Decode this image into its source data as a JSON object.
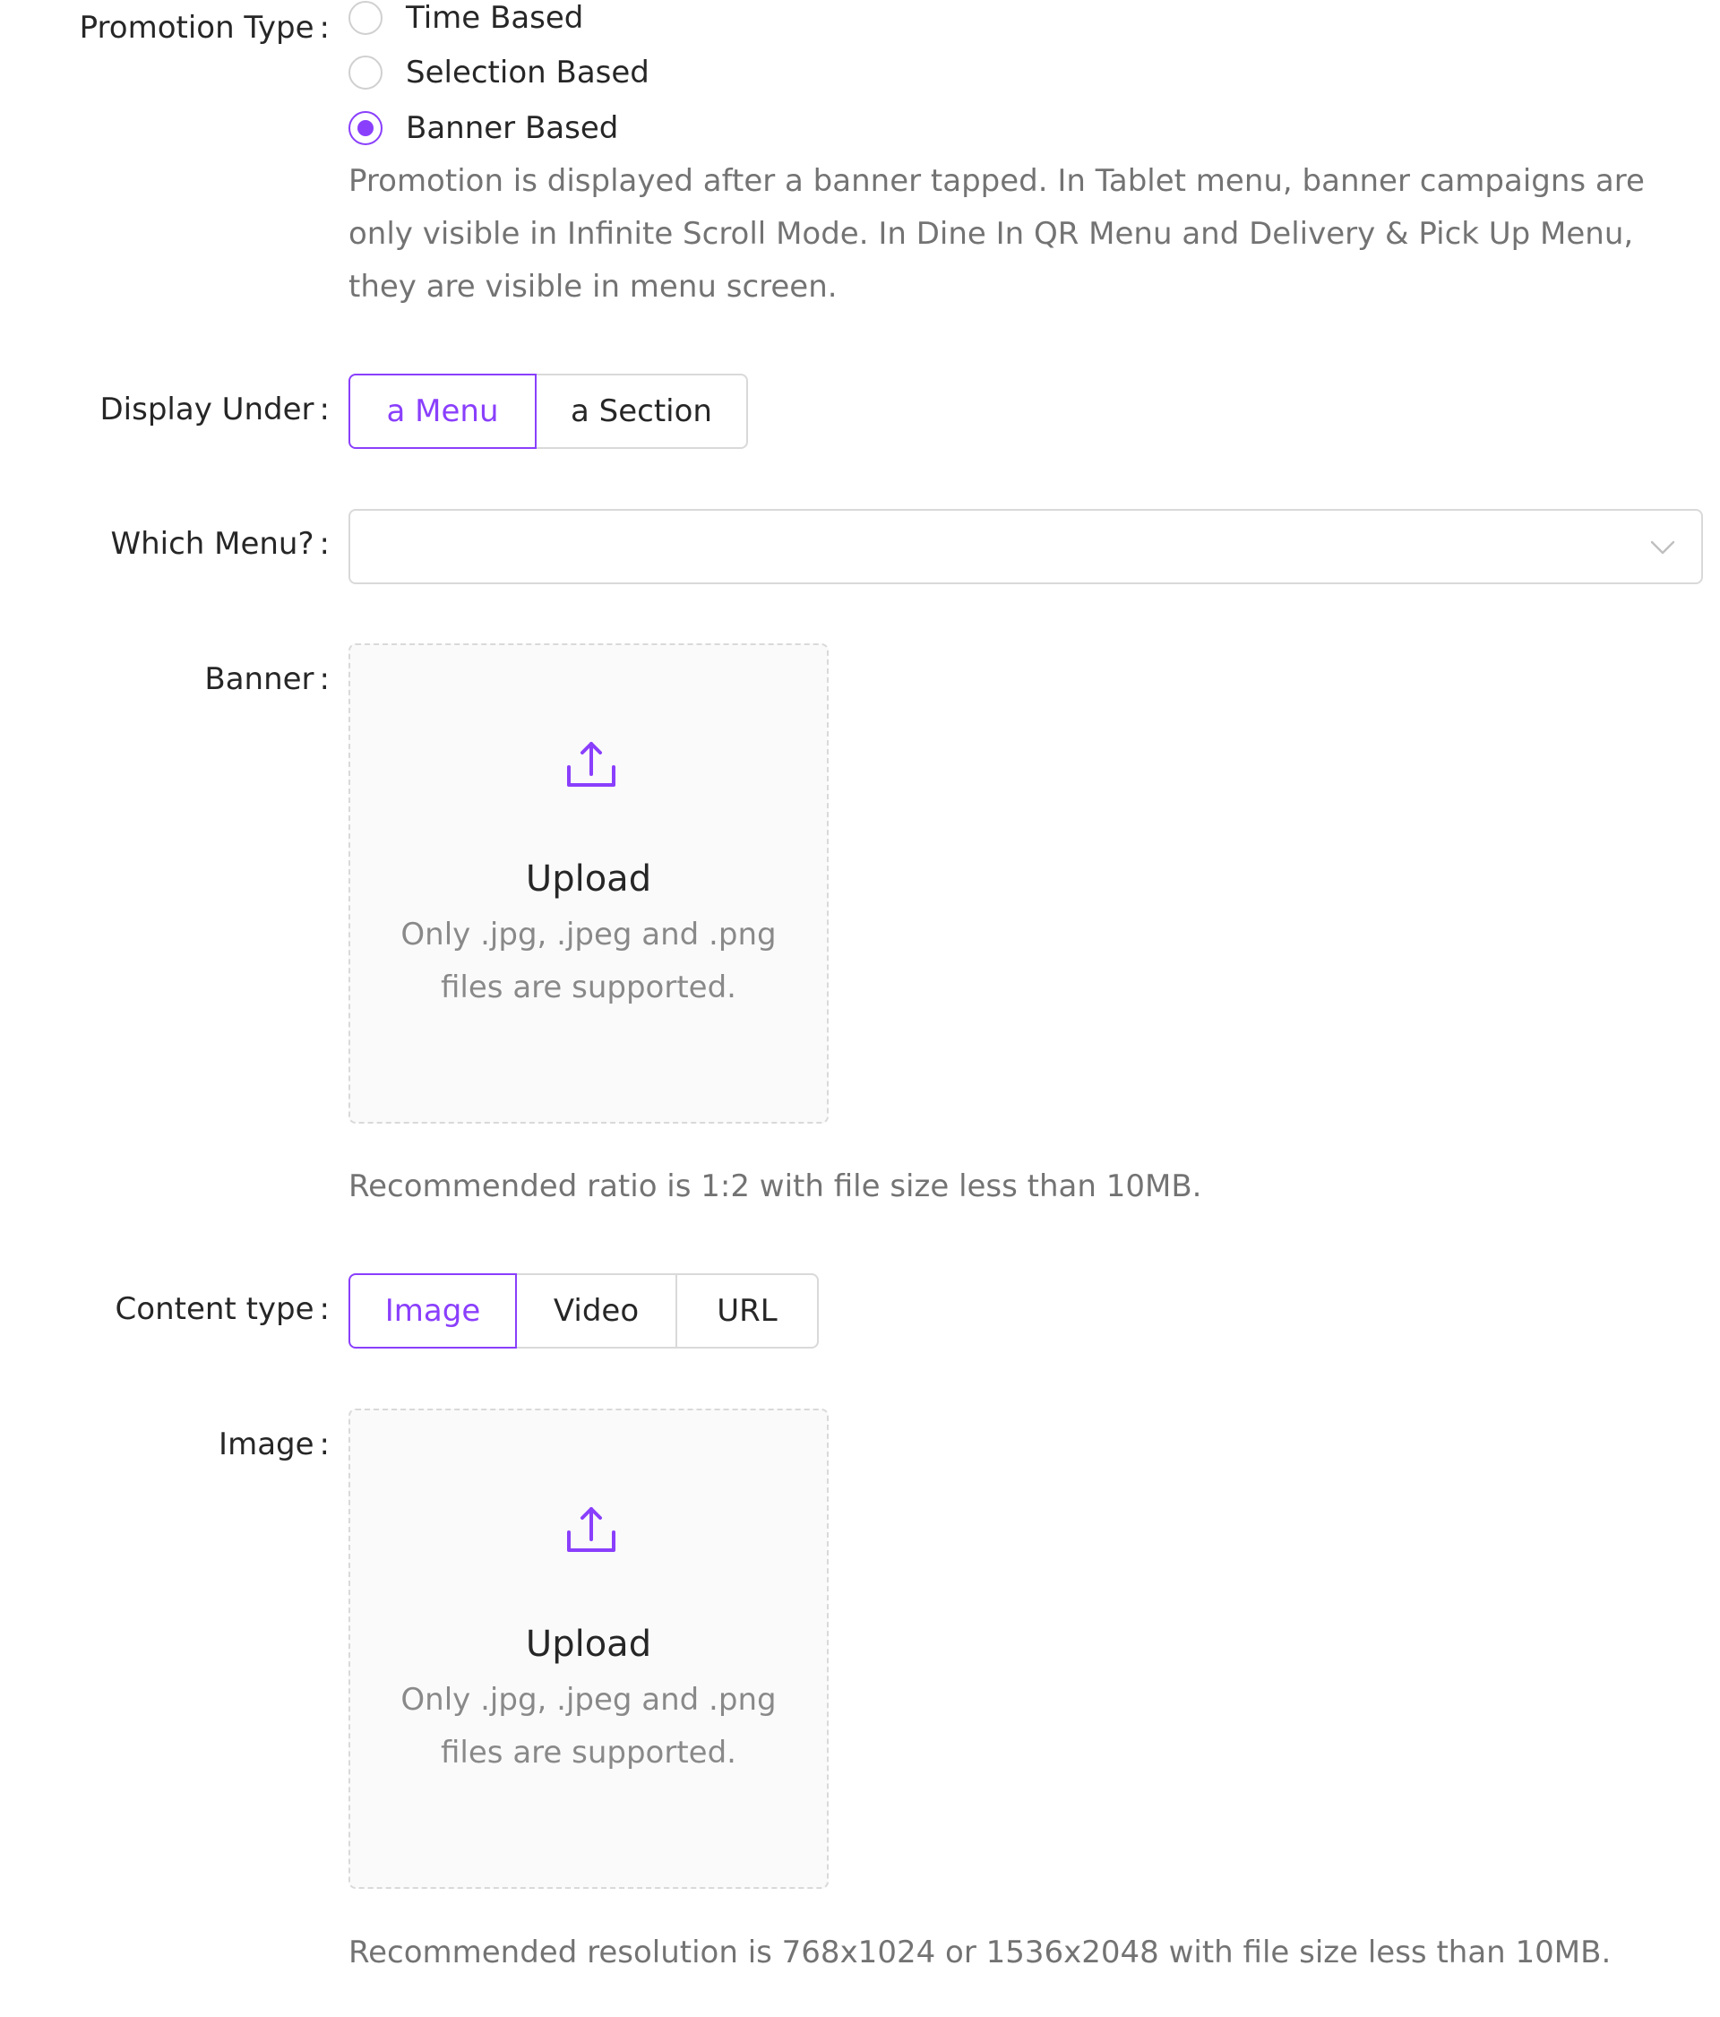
{
  "promotion_type": {
    "label": "Promotion Type",
    "options": [
      {
        "label": "Time Based",
        "checked": false
      },
      {
        "label": "Selection Based",
        "checked": false
      },
      {
        "label": "Banner Based",
        "checked": true
      }
    ],
    "help": "Promotion is displayed after a banner tapped. In Tablet menu, banner campaigns are only visible in Infinite Scroll Mode. In Dine In QR Menu and Delivery & Pick Up Menu, they are visible in menu screen."
  },
  "display_under": {
    "label": "Display Under",
    "options": [
      "a Menu",
      "a Section"
    ],
    "selected": "a Menu"
  },
  "which_menu": {
    "label": "Which Menu?",
    "value": "",
    "icon": "chevron-down-icon"
  },
  "banner": {
    "label": "Banner",
    "upload_title": "Upload",
    "upload_desc": "Only .jpg, .jpeg and .png files are supported.",
    "note": "Recommended ratio is 1:2 with file size less than 10MB.",
    "icon": "upload-icon"
  },
  "content_type": {
    "label": "Content type",
    "options": [
      "Image",
      "Video",
      "URL"
    ],
    "selected": "Image"
  },
  "image": {
    "label": "Image",
    "upload_title": "Upload",
    "upload_desc": "Only .jpg, .jpeg and .png files are supported.",
    "note": "Recommended resolution is 768x1024 or 1536x2048 with file size less than 10MB.",
    "icon": "upload-icon"
  },
  "colors": {
    "accent": "#8a3ffc",
    "border": "#d9d9d9",
    "muted_text": "#8c8c8c"
  }
}
